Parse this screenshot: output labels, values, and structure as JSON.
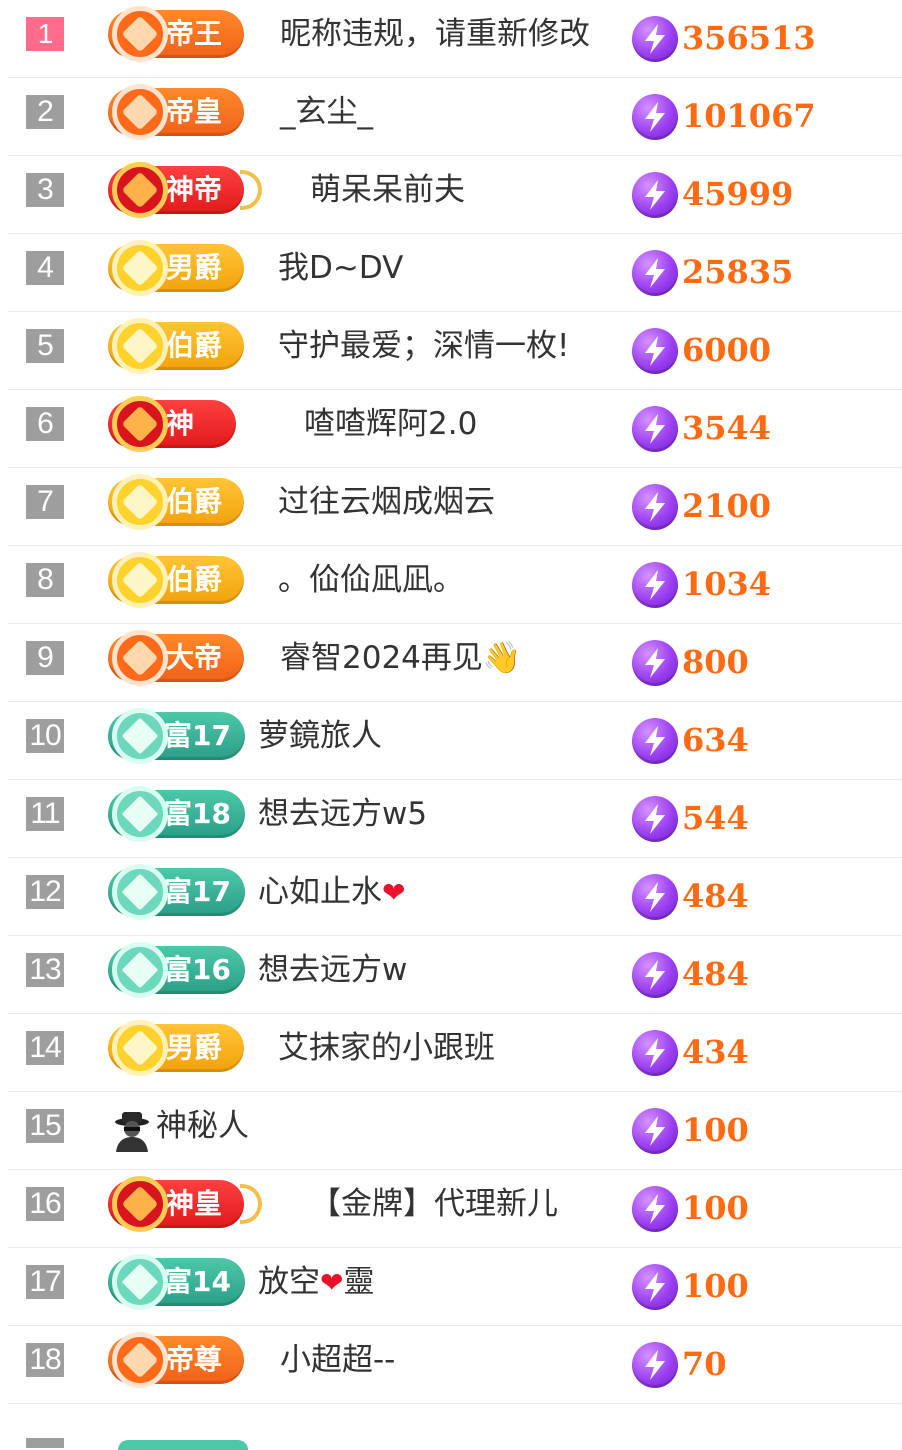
{
  "colors": {
    "rank_default": "#9e9e9e",
    "rank_top1": "#ff6b8a",
    "score": "#ff6a12",
    "nickname": "#333333",
    "divider": "#ececec"
  },
  "rows": [
    {
      "rank": "1",
      "badge": {
        "label": "帝王",
        "style": "orange",
        "icon": "crown-emblem-icon"
      },
      "nickname": "昵称违规，请重新修改",
      "score": "356513"
    },
    {
      "rank": "2",
      "badge": {
        "label": "帝皇",
        "style": "orange",
        "icon": "gem-emblem-icon"
      },
      "nickname": "_玄尘_",
      "score": "101067"
    },
    {
      "rank": "3",
      "badge": {
        "label": "神帝",
        "style": "red",
        "icon": "flower-emblem-icon"
      },
      "nickname": "萌呆呆前夫",
      "score": "45999"
    },
    {
      "rank": "4",
      "badge": {
        "label": "男爵",
        "style": "gold",
        "icon": "diamond-emblem-icon"
      },
      "nickname": "我D~DV",
      "score": "25835"
    },
    {
      "rank": "5",
      "badge": {
        "label": "伯爵",
        "style": "gold",
        "icon": "diamond-emblem-icon"
      },
      "nickname": "守护最爱；深情一枚!",
      "score": "6000"
    },
    {
      "rank": "6",
      "badge": {
        "label": "神",
        "style": "red",
        "icon": "chevron-emblem-icon"
      },
      "nickname": "喳喳辉阿2.0",
      "score": "3544"
    },
    {
      "rank": "7",
      "badge": {
        "label": "伯爵",
        "style": "gold",
        "icon": "diamond-emblem-icon"
      },
      "nickname": "过往云烟成烟云",
      "score": "2100"
    },
    {
      "rank": "8",
      "badge": {
        "label": "伯爵",
        "style": "gold",
        "icon": "diamond-emblem-icon"
      },
      "nickname": "。佡佡凪凪。",
      "score": "1034"
    },
    {
      "rank": "9",
      "badge": {
        "label": "大帝",
        "style": "orange",
        "icon": "chevron-emblem-icon"
      },
      "nickname": "睿智2024再见👋",
      "score": "800"
    },
    {
      "rank": "10",
      "badge": {
        "label": "富17",
        "style": "teal",
        "icon": "triangle-emblem-icon"
      },
      "nickname": "萝鏡旅人",
      "score": "634"
    },
    {
      "rank": "11",
      "badge": {
        "label": "富18",
        "style": "teal",
        "icon": "triangle-emblem-icon"
      },
      "nickname": "想去远方w5",
      "score": "544"
    },
    {
      "rank": "12",
      "badge": {
        "label": "富17",
        "style": "teal",
        "icon": "triangle-emblem-icon"
      },
      "nickname": "心如止水",
      "nickname_suffix": "❤",
      "score": "484"
    },
    {
      "rank": "13",
      "badge": {
        "label": "富16",
        "style": "teal",
        "icon": "triangle-emblem-icon"
      },
      "nickname": "想去远方w",
      "score": "484"
    },
    {
      "rank": "14",
      "badge": {
        "label": "男爵",
        "style": "gold",
        "icon": "diamond-emblem-icon"
      },
      "nickname": "艾抹家的小跟班",
      "score": "434"
    },
    {
      "rank": "15",
      "badge": null,
      "avatar": "mystery-person-icon",
      "nickname": "神秘人",
      "score": "100"
    },
    {
      "rank": "16",
      "badge": {
        "label": "神皇",
        "style": "red",
        "icon": "flower-emblem-icon"
      },
      "nickname": "【金牌】代理新儿",
      "score": "100"
    },
    {
      "rank": "17",
      "badge": {
        "label": "富14",
        "style": "teal",
        "icon": "triangle-emblem-icon"
      },
      "nickname": "放空",
      "nickname_suffix": "❤",
      "nickname_after": "靈",
      "score": "100"
    },
    {
      "rank": "18",
      "badge": {
        "label": "帝尊",
        "style": "orange",
        "icon": "gem-emblem-icon"
      },
      "nickname": "小超超--",
      "score": "70"
    }
  ]
}
